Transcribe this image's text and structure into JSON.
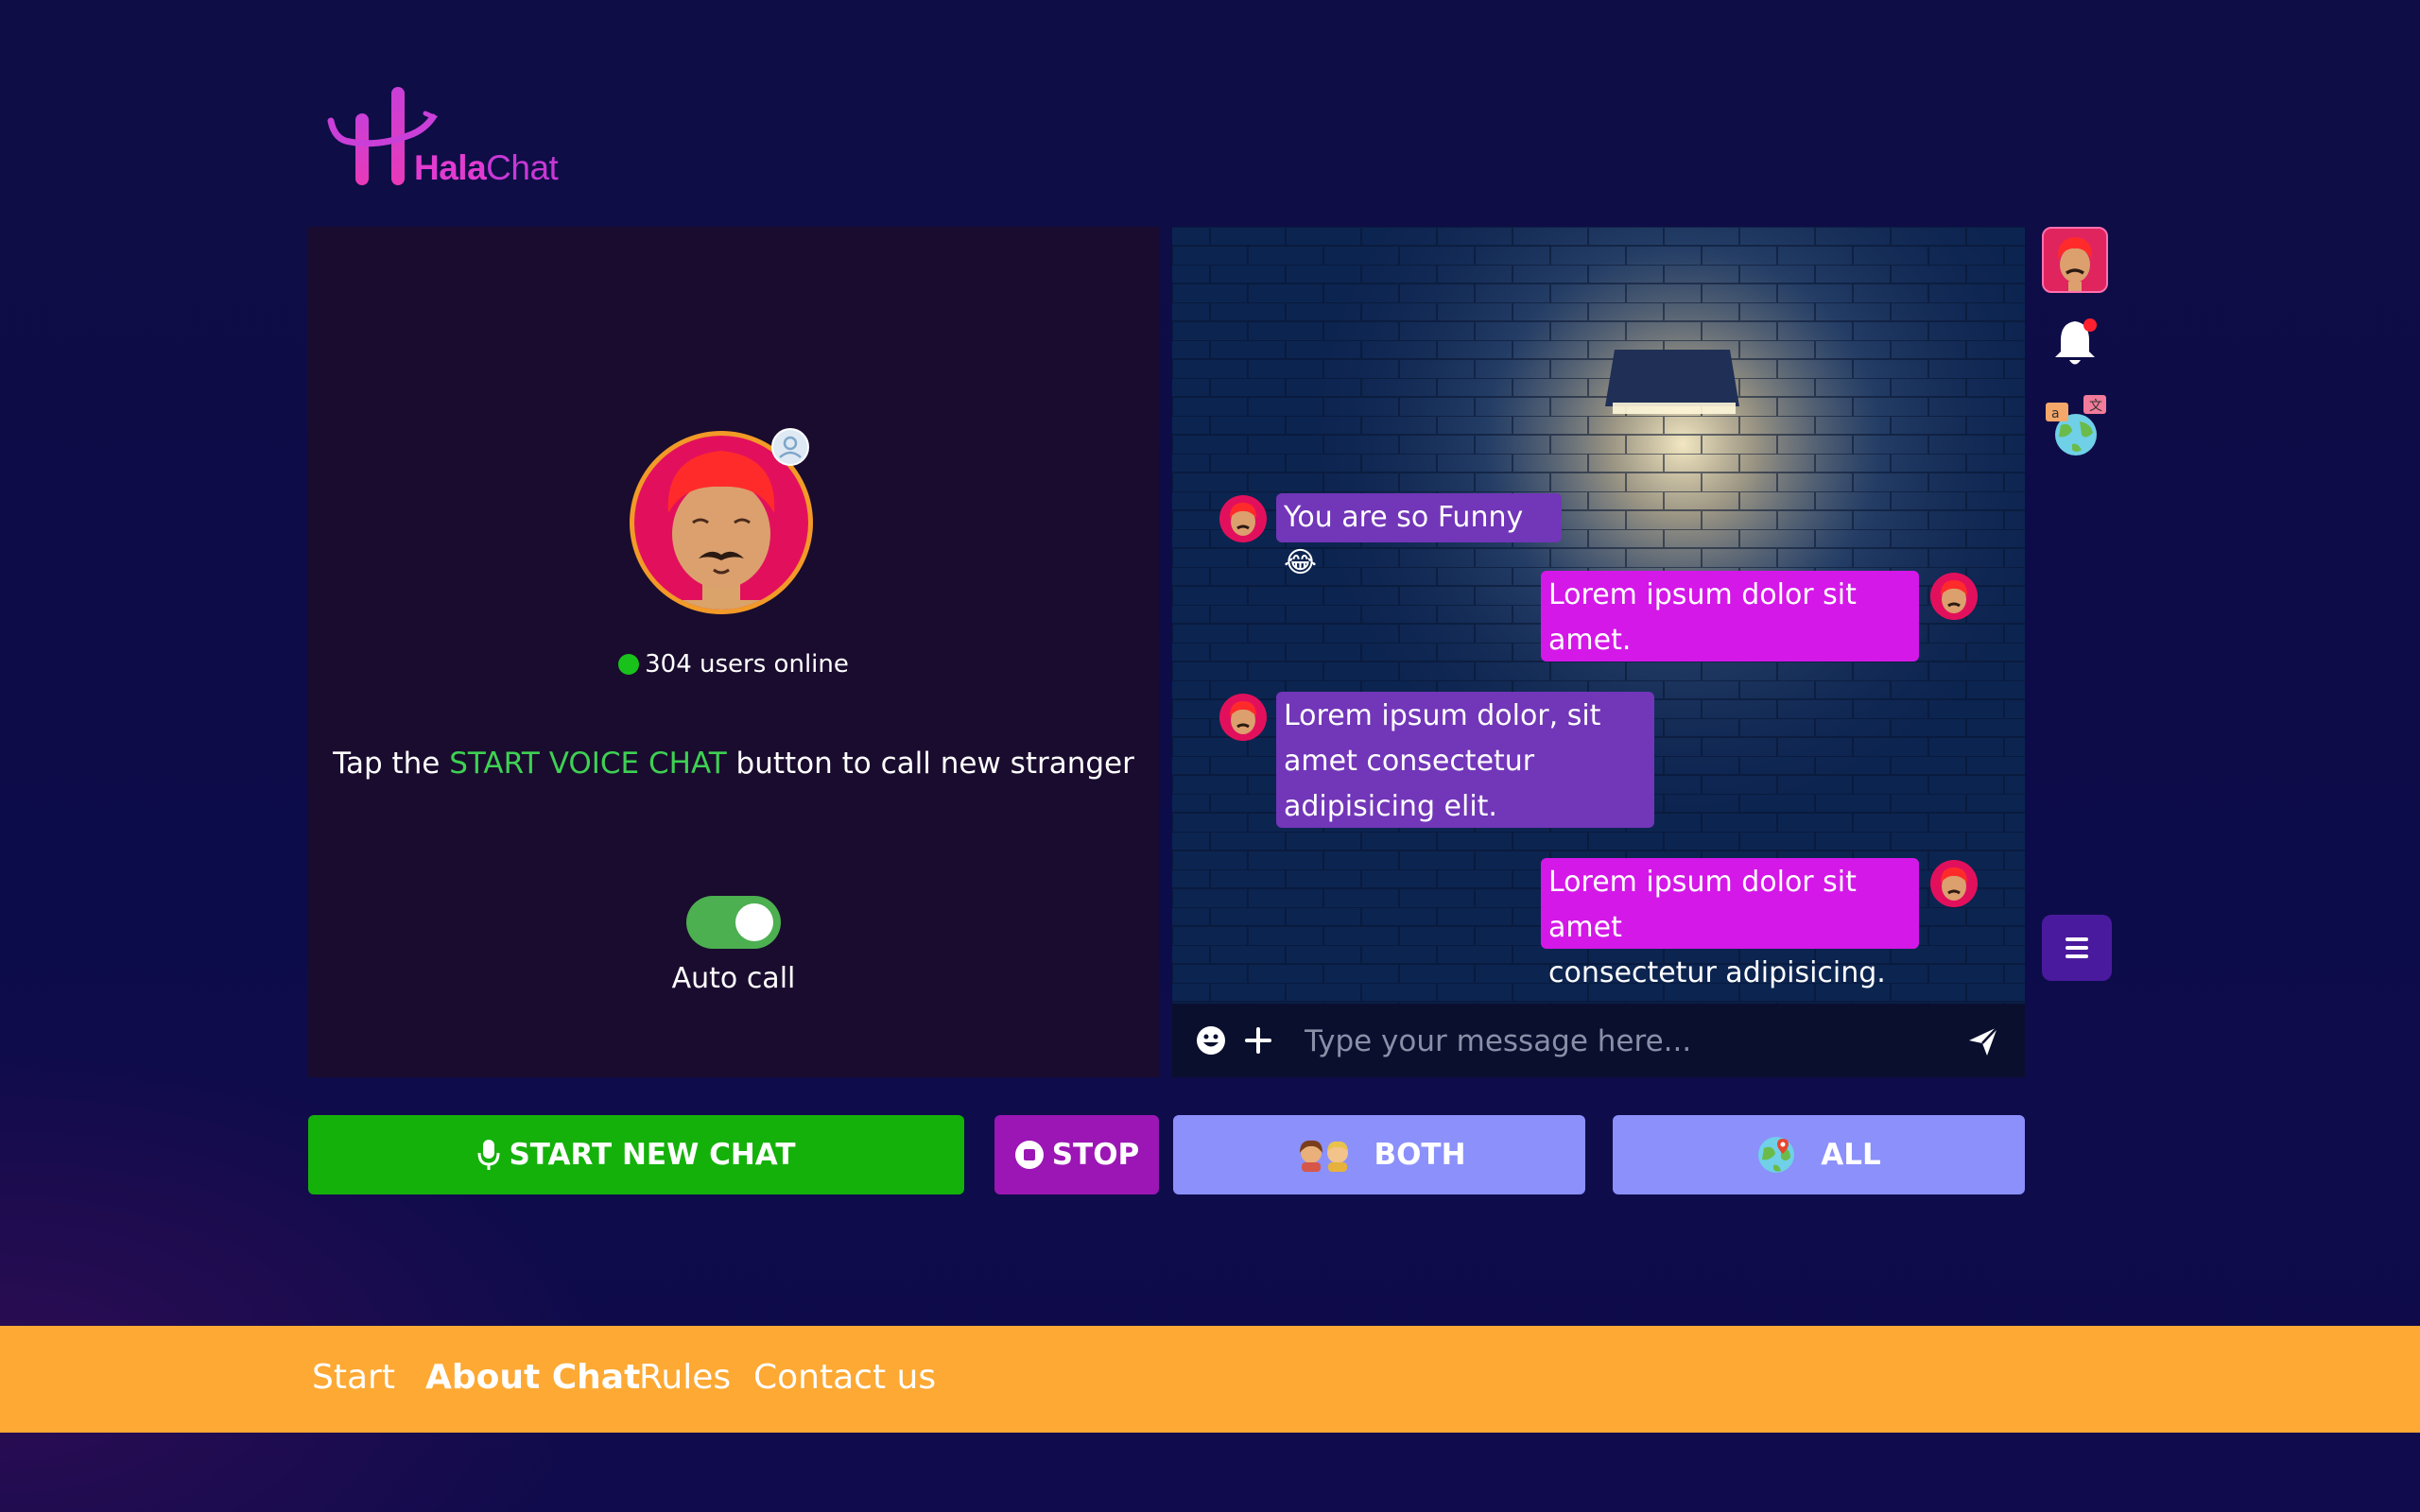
{
  "brand": {
    "logo_part1": "Hala",
    "logo_part2": "Chat"
  },
  "left_panel": {
    "users_online": "304 users online",
    "instruction": {
      "pre": "Tap the ",
      "highlight": "START VOICE CHAT",
      "post": " button to call new stranger"
    },
    "auto_call": {
      "label": "Auto call",
      "enabled": true
    }
  },
  "chat": {
    "messages": [
      {
        "side": "received",
        "text": "You are so Funny 😂"
      },
      {
        "side": "sent",
        "line1": "Lorem ipsum dolor sit",
        "line2": "amet."
      },
      {
        "side": "received",
        "line1": "Lorem ipsum dolor, sit",
        "line2": "amet consectetur",
        "line3": "adipisicing elit."
      },
      {
        "side": "sent",
        "line1": "Lorem ipsum dolor sit amet",
        "line2": "consectetur adipisicing. 😂"
      }
    ],
    "input_placeholder": "Type your message here..."
  },
  "sidebar": {
    "notification_dot": true
  },
  "buttons": {
    "start": "START NEW CHAT",
    "stop": "STOP",
    "both": "BOTH",
    "all": "ALL"
  },
  "footer": {
    "links": [
      "Start",
      "About Chat",
      "Rules",
      "Contact us"
    ],
    "active": "About Chat"
  },
  "colors": {
    "accent_green": "#14b10a",
    "stop_purple": "#9b16b4",
    "filter_blue": "#8b90fb",
    "footer_orange": "#fda934",
    "sent_bubble": "#d418e8",
    "received_bubble": "#7236b8"
  }
}
